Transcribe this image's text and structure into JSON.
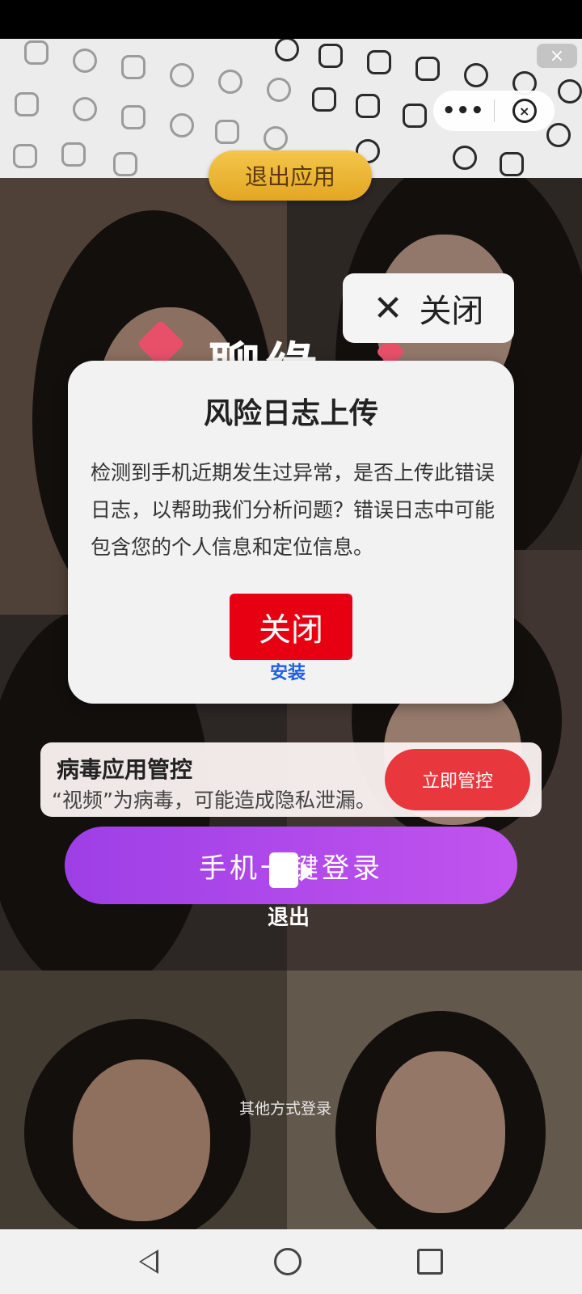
{
  "top_bar": {
    "exit_app_label": "退出应用",
    "corner_close_icon": "close-icon"
  },
  "capsule": {
    "more_icon": "more-icon",
    "more_glyph": "•••",
    "close_icon": "close-circle-icon",
    "close_glyph": "×"
  },
  "close_overlay": {
    "label": "关闭",
    "icon": "close-icon",
    "icon_glyph": "✕"
  },
  "app_logo": {
    "text": "聊缘"
  },
  "dialog": {
    "title": "风险日志上传",
    "body": "检测到手机近期发生过异常，是否上传此错误日志，以帮助我们分析问题？错误日志中可能包含您的个人信息和定位信息。",
    "close_button_label": "关闭",
    "install_label": "安装"
  },
  "virus_banner": {
    "title": "病毒应用管控",
    "description": "“视频”为病毒，可能造成隐私泄漏。",
    "action_label": "立即管控",
    "accent_color": "#e8383e"
  },
  "login": {
    "phone_login_label": "手机一键登录",
    "exit_label": "退出",
    "other_methods_label": "其他方式登录"
  },
  "nav": {
    "back_icon": "back-icon",
    "home_icon": "home-icon",
    "recents_icon": "recents-icon"
  },
  "colors": {
    "login_gradient_start": "#9d3fe6",
    "login_gradient_end": "#c254ee",
    "red_button": "#e60012",
    "exit_pill": "#f0b83a"
  }
}
